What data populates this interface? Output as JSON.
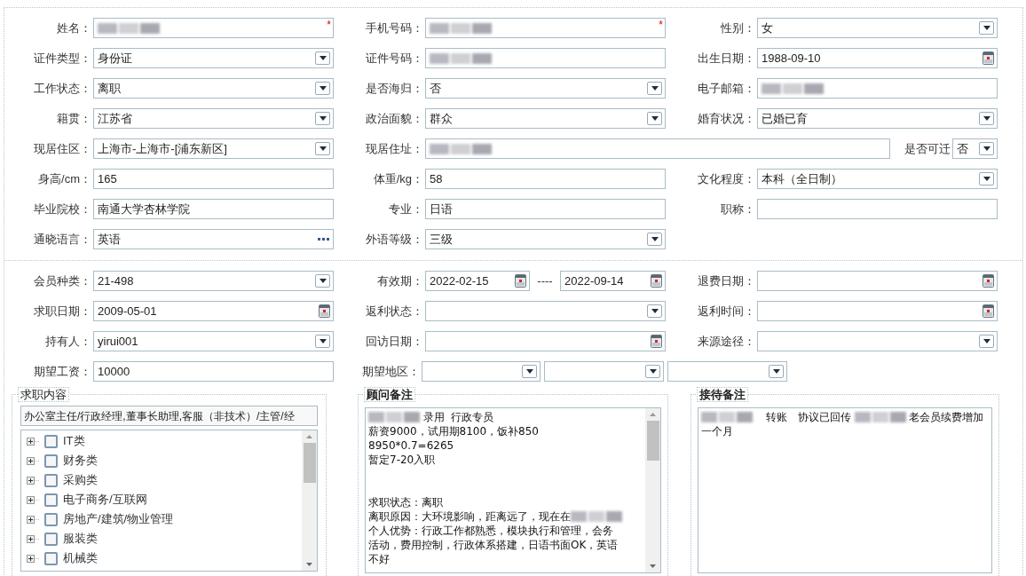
{
  "profile_rows": [
    [
      {
        "label": "姓名：",
        "kind": "text",
        "redacted": true,
        "required_mark": "*"
      },
      {
        "label": "手机号码：",
        "kind": "text",
        "redacted": true,
        "required_mark": "*"
      },
      {
        "label": "性别：",
        "kind": "select",
        "value": "女"
      }
    ],
    [
      {
        "label": "证件类型：",
        "kind": "select",
        "value": "身份证"
      },
      {
        "label": "证件号码：",
        "kind": "text",
        "redacted": true
      },
      {
        "label": "出生日期：",
        "kind": "date",
        "value": "1988-09-10"
      }
    ],
    [
      {
        "label": "工作状态：",
        "kind": "select",
        "value": "离职"
      },
      {
        "label": "是否海归：",
        "kind": "select",
        "value": "否"
      },
      {
        "label": "电子邮箱：",
        "kind": "text",
        "redacted": true
      }
    ],
    [
      {
        "label": "籍贯：",
        "kind": "select",
        "value": "江苏省"
      },
      {
        "label": "政治面貌：",
        "kind": "select",
        "value": "群众"
      },
      {
        "label": "婚育状况：",
        "kind": "select",
        "value": "已婚已育"
      }
    ],
    [
      {
        "label": "现居住区：",
        "kind": "select",
        "value": "上海市-上海市-[浦东新区]"
      },
      {
        "label": "现居住址：",
        "kind": "text",
        "redacted": true,
        "attached": {
          "label": "是否可迁",
          "kind": "select",
          "value": "否"
        }
      }
    ],
    [
      {
        "label": "身高/cm：",
        "kind": "text",
        "value": "165"
      },
      {
        "label": "体重/kg：",
        "kind": "text",
        "value": "58"
      },
      {
        "label": "文化程度：",
        "kind": "select",
        "value": "本科（全日制）"
      }
    ],
    [
      {
        "label": "毕业院校：",
        "kind": "text",
        "value": "南通大学杏林学院"
      },
      {
        "label": "专业：",
        "kind": "text",
        "value": "日语"
      },
      {
        "label": "职称：",
        "kind": "text"
      }
    ],
    [
      {
        "label": "通晓语言：",
        "kind": "lookup",
        "value": "英语"
      },
      {
        "label": "外语等级：",
        "kind": "select",
        "value": "三级"
      }
    ]
  ],
  "member_rows": [
    [
      {
        "label": "会员种类：",
        "kind": "select",
        "value": "21-498"
      },
      {
        "label": "有效期：",
        "kind": "date",
        "value": "2022-02-15",
        "range": {
          "separator": "----",
          "kind": "date",
          "value": "2022-09-14"
        }
      },
      {
        "label": "退费日期：",
        "kind": "date"
      }
    ],
    [
      {
        "label": "求职日期：",
        "kind": "date",
        "value": "2009-05-01"
      },
      {
        "label": "返利状态：",
        "kind": "select"
      },
      {
        "label": "返利时间：",
        "kind": "date"
      }
    ],
    [
      {
        "label": "持有人：",
        "kind": "select",
        "value": "yirui001"
      },
      {
        "label": "回访日期：",
        "kind": "date"
      },
      {
        "label": "来源途径：",
        "kind": "select"
      }
    ],
    [
      {
        "label": "期望工资：",
        "kind": "text",
        "value": "10000"
      },
      {
        "label": "期望地区：",
        "kind": "regions",
        "selects": [
          {
            "kind": "select"
          },
          {
            "kind": "select"
          },
          {
            "kind": "select"
          }
        ]
      }
    ]
  ],
  "job_intent": {
    "legend": "求职内容",
    "value": "办公室主任/行政经理,董事长助理,客服（非技术）/主管/经",
    "categories": [
      {
        "label": "IT类",
        "checked": false,
        "expanded": false
      },
      {
        "label": "财务类",
        "checked": false,
        "expanded": false
      },
      {
        "label": "采购类",
        "checked": false,
        "expanded": false
      },
      {
        "label": "电子商务/互联网",
        "checked": false,
        "expanded": false
      },
      {
        "label": "房地产/建筑/物业管理",
        "checked": false,
        "expanded": false
      },
      {
        "label": "服装类",
        "checked": false,
        "expanded": false
      },
      {
        "label": "机械类",
        "checked": false,
        "expanded": false
      }
    ]
  },
  "notes": [
    {
      "legend": "顾问备注",
      "scrollbar": true,
      "lines": [
        {
          "segments": [
            {
              "kind": "redacted"
            },
            {
              "kind": "text",
              "text": " 录用  行政专员"
            }
          ]
        },
        {
          "segments": [
            {
              "kind": "text",
              "text": "薪资9000，试用期8100，饭补850"
            }
          ]
        },
        {
          "segments": [
            {
              "kind": "text",
              "text": "8950*0.7=6265"
            }
          ]
        },
        {
          "segments": [
            {
              "kind": "text",
              "text": "暂定7-20入职"
            }
          ]
        },
        {
          "kind": "blank"
        },
        {
          "kind": "blank"
        },
        {
          "segments": [
            {
              "kind": "text",
              "text": "求职状态：离职"
            }
          ]
        },
        {
          "segments": [
            {
              "kind": "text",
              "text": "离职原因：大环境影响，距离远了，现在在"
            },
            {
              "kind": "redacted"
            }
          ]
        },
        {
          "segments": [
            {
              "kind": "text",
              "text": "个人优势：行政工作都熟悉，模块执行和管理，会务"
            }
          ]
        },
        {
          "segments": [
            {
              "kind": "text",
              "text": "活动，费用控制，行政体系搭建，日语书面OK，英语"
            }
          ]
        },
        {
          "segments": [
            {
              "kind": "text",
              "text": "不好"
            }
          ]
        }
      ]
    },
    {
      "legend": "接待备注",
      "scrollbar": false,
      "lines": [
        {
          "segments": [
            {
              "kind": "redacted"
            },
            {
              "kind": "text",
              "text": "    转账   协议已回传 "
            },
            {
              "kind": "redacted"
            },
            {
              "kind": "text",
              "text": " 老会员续费增加"
            }
          ]
        },
        {
          "segments": [
            {
              "kind": "text",
              "text": "一个月"
            }
          ]
        }
      ]
    }
  ]
}
